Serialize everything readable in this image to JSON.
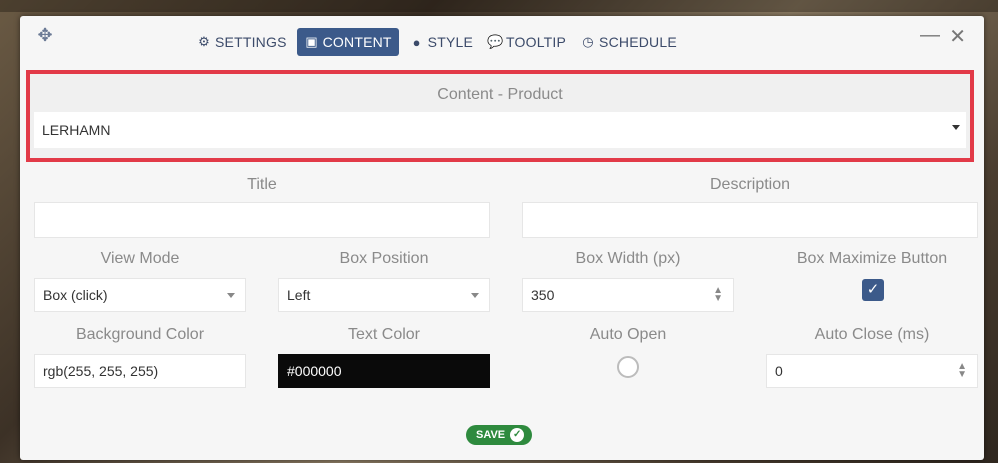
{
  "header": {
    "tabs": [
      {
        "label": "SETTINGS",
        "icon": "gear-icon"
      },
      {
        "label": "CONTENT",
        "icon": "content-icon"
      },
      {
        "label": "STYLE",
        "icon": "palette-icon"
      },
      {
        "label": "TOOLTIP",
        "icon": "speech-bubble-icon"
      },
      {
        "label": "SCHEDULE",
        "icon": "clock-icon"
      }
    ],
    "active_tab": "CONTENT",
    "minimize_label": "—",
    "close_label": "✕"
  },
  "product": {
    "label": "Content - Product",
    "value": "LERHAMN"
  },
  "fields": {
    "title_label": "Title",
    "title_value": "",
    "description_label": "Description",
    "description_value": "",
    "view_mode_label": "View Mode",
    "view_mode_value": "Box (click)",
    "box_position_label": "Box Position",
    "box_position_value": "Left",
    "box_width_label": "Box Width (px)",
    "box_width_value": "350",
    "box_maximize_label": "Box Maximize Button",
    "box_maximize_checked": true,
    "background_color_label": "Background Color",
    "background_color_value": "rgb(255, 255, 255)",
    "text_color_label": "Text Color",
    "text_color_value": "#000000",
    "auto_open_label": "Auto Open",
    "auto_open_checked": false,
    "auto_close_label": "Auto Close (ms)",
    "auto_close_value": "0"
  },
  "footer": {
    "save_label": "SAVE"
  },
  "colors": {
    "accent": "#3c5a8a",
    "highlight": "#e23a48",
    "save": "#2e8a3e"
  }
}
